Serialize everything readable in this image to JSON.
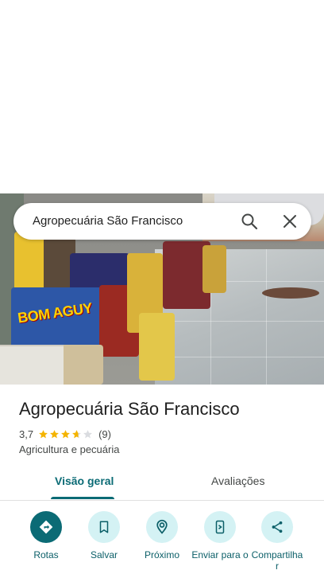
{
  "search": {
    "query": "Agropecuária São Francisco"
  },
  "photo": {
    "bag_brand_text": "BOM AGUY"
  },
  "place": {
    "name": "Agropecuária São Francisco",
    "rating": "3,7",
    "stars_value": 3.7,
    "review_count": "(9)",
    "category": "Agricultura e pecuária"
  },
  "tabs": [
    {
      "label": "Visão geral",
      "active": true
    },
    {
      "label": "Avaliações",
      "active": false
    }
  ],
  "actions": [
    {
      "label": "Rotas",
      "icon": "directions-icon"
    },
    {
      "label": "Salvar",
      "icon": "bookmark-icon"
    },
    {
      "label": "Próximo",
      "icon": "nearby-icon"
    },
    {
      "label": "Enviar para o",
      "icon": "send-to-phone-icon"
    },
    {
      "label": "Compartilha r",
      "icon": "share-icon"
    }
  ],
  "colors": {
    "accent": "#0b6b75",
    "action_bg": "#d4f2f4",
    "star": "#f4b400"
  }
}
